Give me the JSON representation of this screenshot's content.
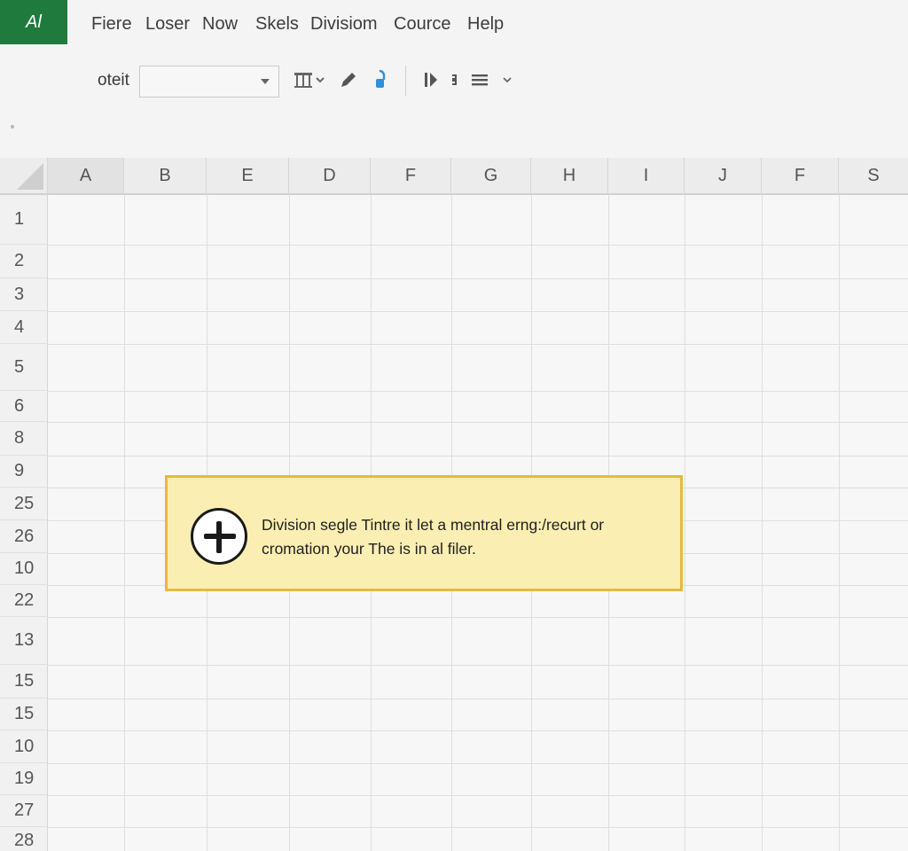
{
  "app": {
    "logo_text": "Al"
  },
  "menu": [
    "Fiere",
    "Loser",
    "Now",
    "Skels",
    "Divisiom",
    "Cource",
    "Help"
  ],
  "toolbar": {
    "label": "oteit",
    "select_value": "",
    "icons": [
      "table-format-icon",
      "pencil-icon",
      "paint-bucket-icon",
      "column-marker-icon",
      "split-icon",
      "align-lines-icon"
    ]
  },
  "columns": [
    "A",
    "B",
    "E",
    "D",
    "F",
    "G",
    "H",
    "I",
    "J",
    "F",
    "S"
  ],
  "rows": [
    "1",
    "2",
    "3",
    "4",
    "5",
    "6",
    "8",
    "9",
    "25",
    "26",
    "10",
    "22",
    "13",
    "15",
    "15",
    "10",
    "19",
    "27",
    "28"
  ],
  "banner": {
    "icon": "add-circle-icon",
    "line1": "Division segle Tintre it let a mentral erng:/recurt or",
    "line2": "cromation your The is in al filer."
  },
  "colors": {
    "brand": "#1f7a3e",
    "banner_bg": "#fbeeb2",
    "banner_border": "#e8b93a"
  }
}
